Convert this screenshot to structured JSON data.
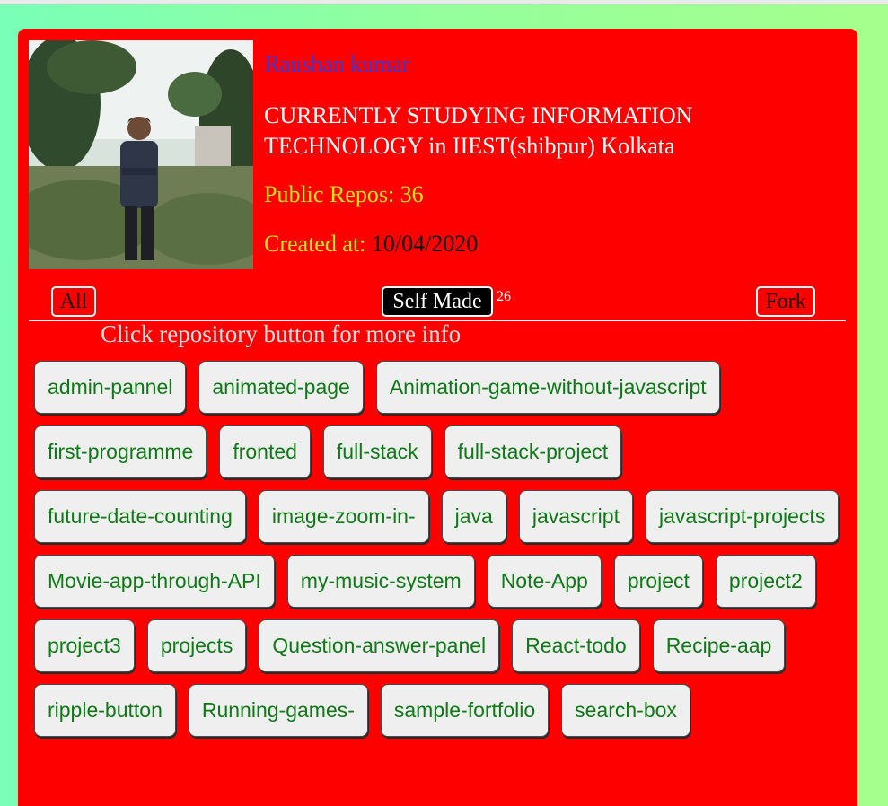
{
  "profile": {
    "name": "Raushan kumar",
    "bio": "CURRENTLY STUDYING INFORMATION TECHNOLOGY in IIEST(shibpur) Kolkata",
    "repos_label": "Public Repos: 36",
    "created_label": "Created at:",
    "created_date": "10/04/2020"
  },
  "tabs": {
    "all": "All",
    "self_made": "Self Made",
    "self_made_count": "26",
    "fork": "Fork"
  },
  "hint": "Click repository button for more info",
  "repos": [
    "admin-pannel",
    "animated-page",
    "Animation-game-without-javascript",
    "first-programme",
    "fronted",
    "full-stack",
    "full-stack-project",
    "future-date-counting",
    "image-zoom-in-",
    "java",
    "javascript",
    "javascript-projects",
    "Movie-app-through-API",
    "my-music-system",
    "Note-App",
    "project",
    "project2",
    "project3",
    "projects",
    "Question-answer-panel",
    "React-todo",
    "Recipe-aap",
    "ripple-button",
    "Running-games-",
    "sample-fortfolio",
    "search-box"
  ],
  "colors": {
    "card": "#ff0000",
    "name": "#3d35d6",
    "accent": "#d7e51b",
    "repo_text": "#0e7a16"
  }
}
